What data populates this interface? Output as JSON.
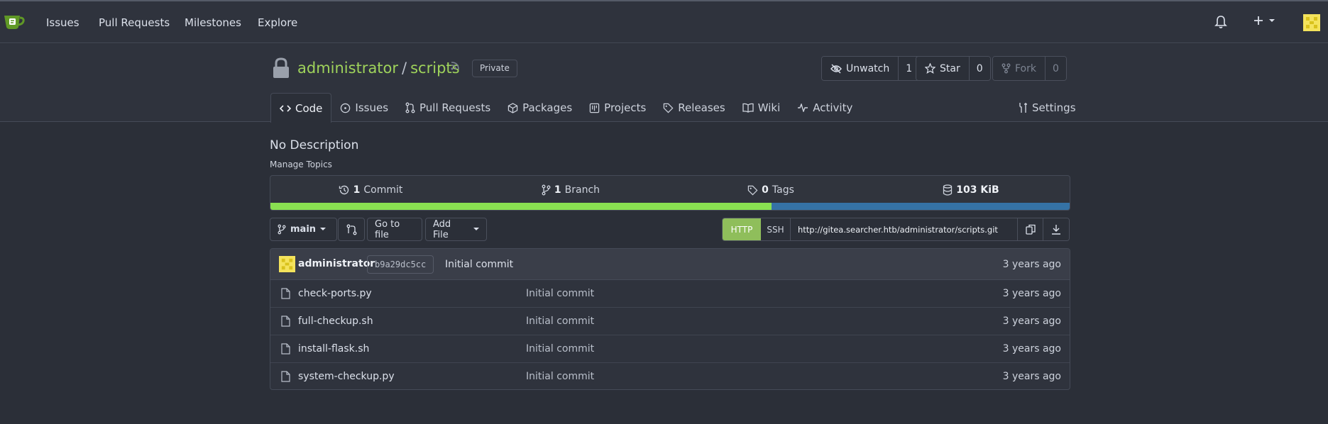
{
  "nav": {
    "links": [
      "Issues",
      "Pull Requests",
      "Milestones",
      "Explore"
    ]
  },
  "repo": {
    "owner": "administrator",
    "separator": "/",
    "name": "scripts",
    "visibility": "Private",
    "watch": {
      "label": "Unwatch",
      "count": "1"
    },
    "star": {
      "label": "Star",
      "count": "0"
    },
    "fork": {
      "label": "Fork",
      "count": "0"
    }
  },
  "tabs": [
    {
      "label": "Code",
      "icon": "code-icon",
      "active": true
    },
    {
      "label": "Issues",
      "icon": "issue-icon"
    },
    {
      "label": "Pull Requests",
      "icon": "pull-request-icon"
    },
    {
      "label": "Packages",
      "icon": "package-icon"
    },
    {
      "label": "Projects",
      "icon": "project-icon"
    },
    {
      "label": "Releases",
      "icon": "tag-icon"
    },
    {
      "label": "Wiki",
      "icon": "book-icon"
    },
    {
      "label": "Activity",
      "icon": "pulse-icon"
    }
  ],
  "settings_label": "Settings",
  "description": "No Description",
  "manage_topics": "Manage Topics",
  "stats": {
    "commits": {
      "count": "1",
      "label": "Commit"
    },
    "branches": {
      "count": "1",
      "label": "Branch"
    },
    "tags": {
      "count": "0",
      "label": "Tags"
    },
    "size": "103 KiB"
  },
  "language_bar": [
    {
      "share": 0.627,
      "color": "#89e051"
    },
    {
      "share": 0.373,
      "color": "#3572a5"
    }
  ],
  "toolbar": {
    "branch": "main",
    "go_to_file": "Go to file",
    "add_file": "Add File"
  },
  "clone": {
    "http": "HTTP",
    "ssh": "SSH",
    "url": "http://gitea.searcher.htb/administrator/scripts.git"
  },
  "latest_commit": {
    "author": "administrator",
    "sha": "b9a29dc5cc",
    "message": "Initial commit",
    "age": "3 years ago"
  },
  "files": [
    {
      "name": "check-ports.py",
      "message": "Initial commit",
      "age": "3 years ago"
    },
    {
      "name": "full-checkup.sh",
      "message": "Initial commit",
      "age": "3 years ago"
    },
    {
      "name": "install-flask.sh",
      "message": "Initial commit",
      "age": "3 years ago"
    },
    {
      "name": "system-checkup.py",
      "message": "Initial commit",
      "age": "3 years ago"
    }
  ],
  "colors": {
    "accent_green": "#9fd35b",
    "http_button": "#8fbe5b",
    "background": "#2b2f38",
    "header": "#2f333d"
  }
}
